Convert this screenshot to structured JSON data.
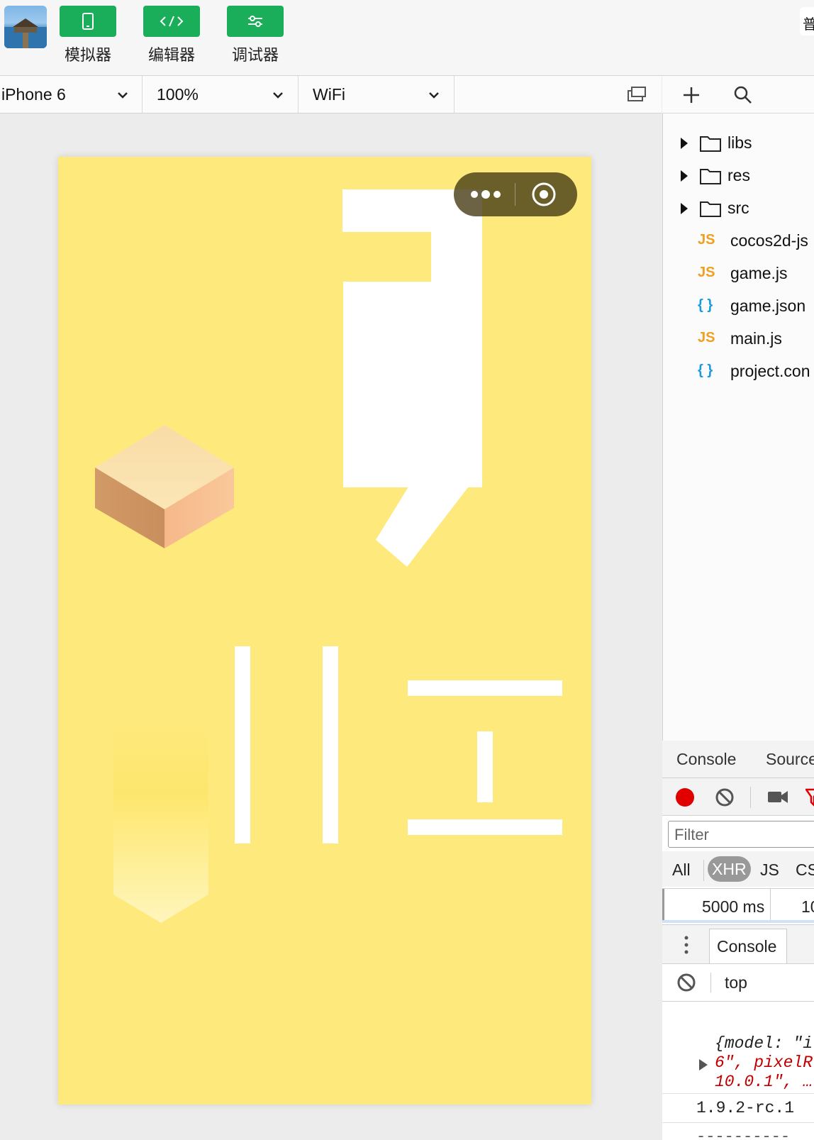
{
  "toolbar": {
    "buttons": [
      {
        "label": "模拟器",
        "icon": "phone-icon"
      },
      {
        "label": "编辑器",
        "icon": "code-icon"
      },
      {
        "label": "调试器",
        "icon": "sliders-icon"
      }
    ],
    "right_tab_text": "普"
  },
  "device_bar": {
    "device": "iPhone 6",
    "zoom": "100%",
    "network": "WiFi"
  },
  "explorer": {
    "folders": [
      "libs",
      "res",
      "src"
    ],
    "files": [
      {
        "type": "JS",
        "name": "cocos2d-js"
      },
      {
        "type": "JS",
        "name": "game.js"
      },
      {
        "type": "{ }",
        "name": "game.json"
      },
      {
        "type": "JS",
        "name": "main.js"
      },
      {
        "type": "{ }",
        "name": "project.con"
      }
    ]
  },
  "devtools": {
    "tabs": [
      "Console",
      "Source"
    ],
    "filter_placeholder": "Filter",
    "types": [
      "All",
      "XHR",
      "JS",
      "CS"
    ],
    "active_type": "XHR",
    "timeline": [
      "5000 ms",
      "10"
    ],
    "drawer_tab": "Console",
    "context": "top",
    "log_lines": [
      {
        "text": "{model: \"i",
        "style": "obj"
      },
      {
        "text": "6\", pixelR",
        "style": "obj"
      },
      {
        "text": "10.0.1\", …",
        "style": "obj"
      },
      {
        "text": "1.9.2-rc.1",
        "style": "plain"
      }
    ]
  },
  "colors": {
    "accent_green": "#1aad5a",
    "game_background": "#fee97c",
    "js_icon": "#f0a020",
    "json_icon": "#1a9be0",
    "record_red": "#e00000"
  }
}
